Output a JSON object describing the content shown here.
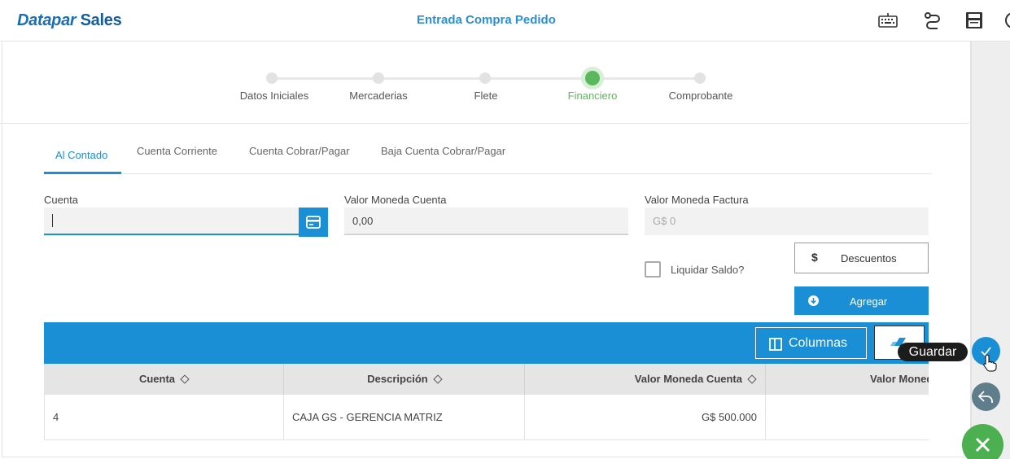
{
  "app": {
    "logo_italic": "Datapar",
    "logo_bold": "Sales",
    "page_title": "Entrada Compra Pedido"
  },
  "header_icons": [
    "keyboard-icon",
    "route-icon",
    "save-disk-icon",
    "clock-icon"
  ],
  "stepper": {
    "steps": [
      {
        "label": "Datos Iniciales",
        "active": false
      },
      {
        "label": "Mercaderias",
        "active": false
      },
      {
        "label": "Flete",
        "active": false
      },
      {
        "label": "Financiero",
        "active": true
      },
      {
        "label": "Comprobante",
        "active": false
      }
    ]
  },
  "tabs": [
    {
      "label": "Al Contado",
      "active": true
    },
    {
      "label": "Cuenta Corriente",
      "active": false
    },
    {
      "label": "Cuenta Cobrar/Pagar",
      "active": false
    },
    {
      "label": "Baja Cuenta Cobrar/Pagar",
      "active": false
    }
  ],
  "form": {
    "cuenta_label": "Cuenta",
    "cuenta_value": "",
    "valor_cuenta_label": "Valor Moneda Cuenta",
    "valor_cuenta_value": "0,00",
    "valor_factura_label": "Valor Moneda Factura",
    "valor_factura_value": "G$ 0",
    "liquidar_label": "Liquidar Saldo?",
    "liquidar_checked": false,
    "descuentos_symbol": "$",
    "descuentos_label": "Descuentos",
    "agregar_label": "Agregar"
  },
  "grid": {
    "columnas_label": "Columnas",
    "tooltip": "Guardar",
    "columns": [
      "Cuenta",
      "Descripción",
      "Valor Moneda Cuenta",
      "Valor Moneda Factura"
    ],
    "rows": [
      {
        "cuenta": "4",
        "descripcion": "CAJA GS - GERENCIA MATRIZ",
        "valor_cuenta": "G$ 500.000",
        "valor_factura": ""
      }
    ]
  },
  "colors": {
    "primary": "#1a8fd6",
    "success": "#5cb85c",
    "undo": "#607d8b",
    "close": "#4caf50"
  }
}
